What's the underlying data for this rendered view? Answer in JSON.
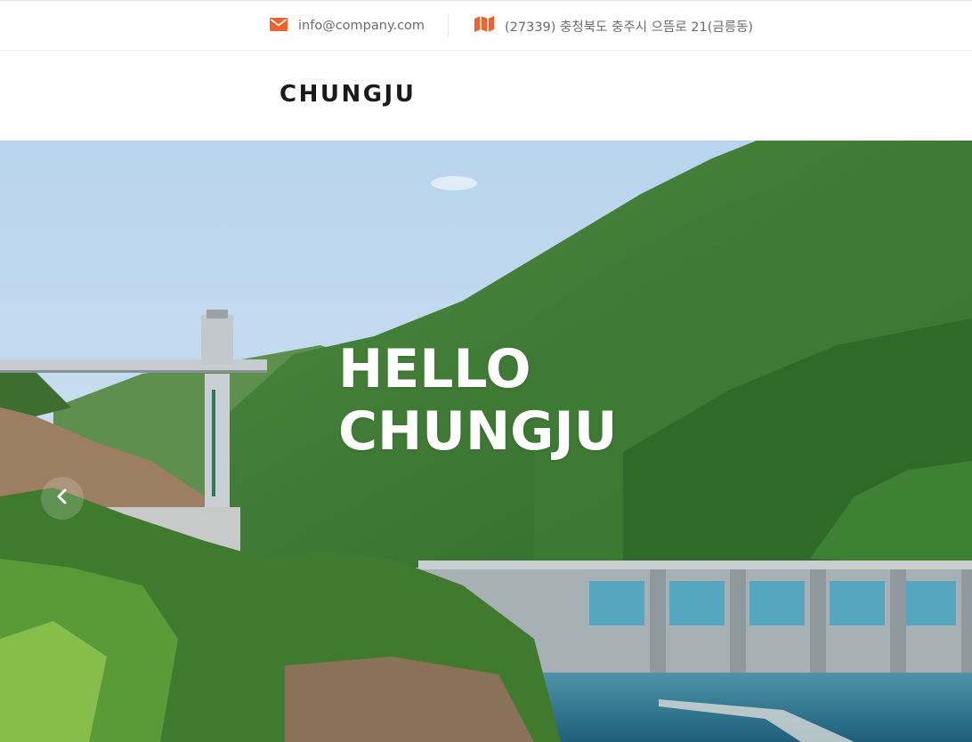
{
  "topbar": {
    "email": "info@company.com",
    "address": "(27339) 충청북도 충주시 으뜸로 21(금릉동)",
    "email_icon": "envelope-icon",
    "address_icon": "map-icon",
    "accent_color": "#f0612d"
  },
  "header": {
    "logo": "CHUNGJU"
  },
  "hero": {
    "title_line1": "HELLO",
    "title_line2": "CHUNGJU",
    "prev_icon": "chevron-left-icon"
  }
}
